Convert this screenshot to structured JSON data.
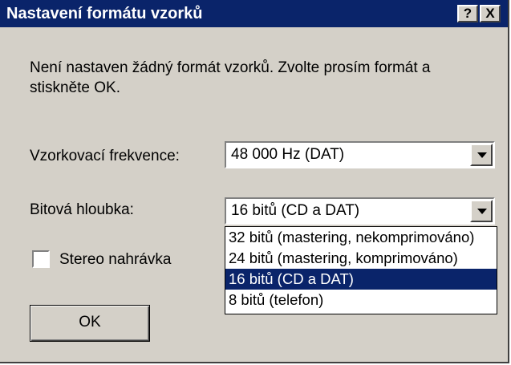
{
  "dialog": {
    "title": "Nastavení formátu vzorků",
    "help_label": "?",
    "close_label": "X",
    "message": "Není nastaven žádný formát vzorků. Zvolte prosím formát a stiskněte OK."
  },
  "sample_rate": {
    "label": "Vzorkovací frekvence:",
    "value": "48 000 Hz (DAT)"
  },
  "bit_depth": {
    "label": "Bitová hloubka:",
    "value": "16 bitů (CD a DAT)",
    "options": [
      "32 bitů (mastering, nekomprimováno)",
      "24 bitů (mastering, komprimováno)",
      "16 bitů (CD a DAT)",
      "8 bitů (telefon)"
    ],
    "selected_option": "16 bitů (CD a DAT)"
  },
  "stereo": {
    "label": "Stereo nahrávka",
    "checked": false
  },
  "buttons": {
    "ok": "OK"
  }
}
